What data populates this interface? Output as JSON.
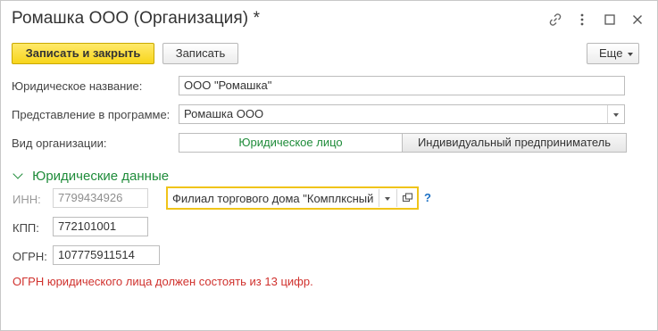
{
  "window": {
    "title": "Ромашка ООО (Организация) *"
  },
  "toolbar": {
    "save_close_label": "Записать и закрыть",
    "save_label": "Записать",
    "more_label": "Еще"
  },
  "form": {
    "legal_name_label": "Юридическое название:",
    "legal_name_value": "ООО \"Ромашка\"",
    "display_label": "Представление в программе:",
    "display_value": "Ромашка ООО",
    "org_type_label": "Вид организации:",
    "org_type_options": [
      "Юридическое лицо",
      "Индивидуальный предприниматель"
    ],
    "org_type_selected": "Юридическое лицо"
  },
  "legal_section": {
    "title": "Юридические данные",
    "inn_label": "ИНН:",
    "inn_value": "7799434926",
    "branch_value": "Филиал торгового дома \"Комплксный",
    "help": "?",
    "kpp_label": "КПП:",
    "kpp_value": "772101001",
    "ogrn_label": "ОГРН:",
    "ogrn_value": "107775911514"
  },
  "error_message": "ОГРН юридического лица должен состоять из 13 цифр.",
  "colors": {
    "accent_green": "#1f8c3a",
    "error_red": "#d0312d",
    "primary_yellow": "#f7d51b",
    "focus_yellow": "#f0c419",
    "link_blue": "#1a6fc4"
  }
}
